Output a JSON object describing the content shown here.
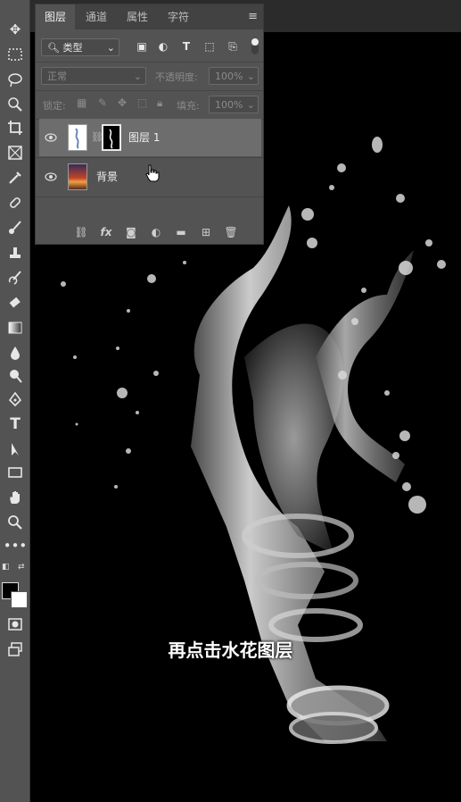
{
  "layers_panel": {
    "tabs": [
      {
        "label": "图层",
        "active": true
      },
      {
        "label": "通道",
        "active": false
      },
      {
        "label": "属性",
        "active": false
      },
      {
        "label": "字符",
        "active": false
      }
    ],
    "filter_kind": "类型",
    "blend_mode": "正常",
    "opacity_label": "不透明度:",
    "opacity_value": "100%",
    "lock_label": "锁定:",
    "fill_label": "填充:",
    "fill_value": "100%",
    "layers": [
      {
        "name": "图层 1",
        "selected": true,
        "visible": true,
        "has_mask": true
      },
      {
        "name": "背景",
        "selected": false,
        "visible": true,
        "has_mask": false
      }
    ],
    "footer_icons": [
      "link-icon",
      "fx-icon",
      "mask-icon",
      "adjustment-icon",
      "folder-icon",
      "new-layer-icon",
      "trash-icon"
    ],
    "fx_label": "fx"
  },
  "toolbar": {
    "tools": [
      "move",
      "marquee",
      "lasso",
      "quick-select",
      "crop",
      "frame",
      "eyedropper",
      "healing",
      "brush",
      "stamp",
      "history-brush",
      "eraser",
      "gradient",
      "blur",
      "dodge",
      "pen",
      "type",
      "path-select",
      "rectangle",
      "hand",
      "zoom",
      "more"
    ]
  },
  "caption": "再点击水花图层",
  "colors": {
    "foreground": "#000000",
    "background": "#ffffff",
    "panel": "#535353",
    "selected_layer": "#6d6d6d"
  }
}
